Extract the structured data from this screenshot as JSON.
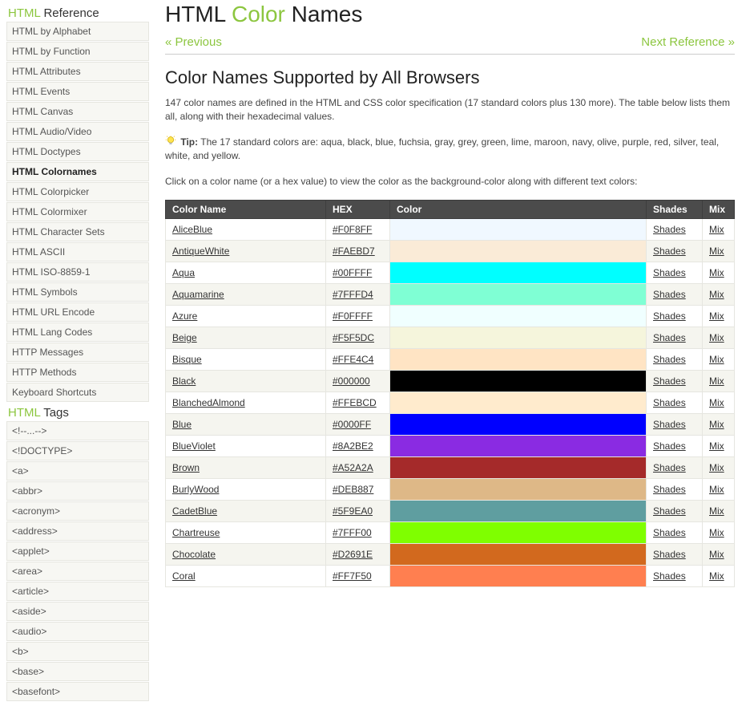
{
  "sidebar": {
    "ref_heading_a": "HTML",
    "ref_heading_b": "Reference",
    "ref_items": [
      "HTML by Alphabet",
      "HTML by Function",
      "HTML Attributes",
      "HTML Events",
      "HTML Canvas",
      "HTML Audio/Video",
      "HTML Doctypes",
      "HTML Colornames",
      "HTML Colorpicker",
      "HTML Colormixer",
      "HTML Character Sets",
      "HTML ASCII",
      "HTML ISO-8859-1",
      "HTML Symbols",
      "HTML URL Encode",
      "HTML Lang Codes",
      "HTTP Messages",
      "HTTP Methods",
      "Keyboard Shortcuts"
    ],
    "ref_current_index": 7,
    "tags_heading_a": "HTML",
    "tags_heading_b": "Tags",
    "tag_items": [
      "<!--...-->",
      "<!DOCTYPE>",
      "<a>",
      "<abbr>",
      "<acronym>",
      "<address>",
      "<applet>",
      "<area>",
      "<article>",
      "<aside>",
      "<audio>",
      "<b>",
      "<base>",
      "<basefont>"
    ]
  },
  "page": {
    "title_a": "HTML",
    "title_b": "Color",
    "title_c": "Names",
    "prev": "« Previous",
    "next": "Next Reference »",
    "subhead": "Color Names Supported by All Browsers",
    "intro": "147 color names are defined in the HTML and CSS color specification (17 standard colors plus 130 more). The table below lists them all, along with their hexadecimal values.",
    "tip_label": "Tip:",
    "tip_text": " The 17 standard colors are: aqua, black, blue, fuchsia, gray, grey, green, lime, maroon, navy, olive, purple, red, silver, teal, white, and yellow.",
    "instruct": "Click on a color name (or a hex value) to view the color as the background-color along with different text colors:"
  },
  "table": {
    "head": {
      "name": "Color Name",
      "hex": "HEX",
      "color": "Color",
      "shades": "Shades",
      "mix": "Mix"
    },
    "shades_label": "Shades",
    "mix_label": "Mix",
    "rows": [
      {
        "name": "AliceBlue",
        "hex": "#F0F8FF"
      },
      {
        "name": "AntiqueWhite",
        "hex": "#FAEBD7"
      },
      {
        "name": "Aqua",
        "hex": "#00FFFF"
      },
      {
        "name": "Aquamarine",
        "hex": "#7FFFD4"
      },
      {
        "name": "Azure",
        "hex": "#F0FFFF"
      },
      {
        "name": "Beige",
        "hex": "#F5F5DC"
      },
      {
        "name": "Bisque",
        "hex": "#FFE4C4"
      },
      {
        "name": "Black",
        "hex": "#000000"
      },
      {
        "name": "BlanchedAlmond",
        "hex": "#FFEBCD"
      },
      {
        "name": "Blue",
        "hex": "#0000FF"
      },
      {
        "name": "BlueViolet",
        "hex": "#8A2BE2"
      },
      {
        "name": "Brown",
        "hex": "#A52A2A"
      },
      {
        "name": "BurlyWood",
        "hex": "#DEB887"
      },
      {
        "name": "CadetBlue",
        "hex": "#5F9EA0"
      },
      {
        "name": "Chartreuse",
        "hex": "#7FFF00"
      },
      {
        "name": "Chocolate",
        "hex": "#D2691E"
      },
      {
        "name": "Coral",
        "hex": "#FF7F50"
      }
    ]
  }
}
